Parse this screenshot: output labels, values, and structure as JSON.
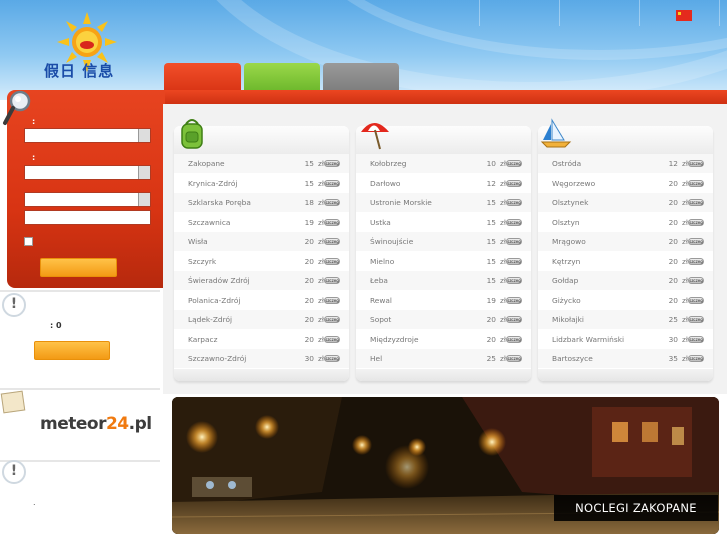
{
  "header": {
    "logo_text": "假日 信息",
    "flag_icon": "china-flag-icon",
    "tabs": [
      {
        "label": "",
        "color": "#e23c1a"
      },
      {
        "label": "",
        "color": "#86c83c"
      },
      {
        "label": "",
        "color": "#8c8c8c"
      }
    ]
  },
  "search": {
    "field1_label": ":",
    "field2_label": ":",
    "field1_value": "",
    "field2_value": "",
    "field3_value": "",
    "field4_value": "",
    "submit_label": ""
  },
  "sidebar": {
    "counter_text": ": 0",
    "button_label": "",
    "partner_logo": {
      "main": "meteor",
      "accent": "24",
      "tail": ".pl"
    },
    "footer_text": "."
  },
  "columns": [
    {
      "icon": "backpack-icon",
      "rows": [
        {
          "town": "Zakopane",
          "price": "15",
          "unit": "zł"
        },
        {
          "town": "Krynica-Zdrój",
          "price": "15",
          "unit": "zł"
        },
        {
          "town": "Szklarska Poręba",
          "price": "18",
          "unit": "zł"
        },
        {
          "town": "Szczawnica",
          "price": "19",
          "unit": "zł"
        },
        {
          "town": "Wisła",
          "price": "20",
          "unit": "zł"
        },
        {
          "town": "Szczyrk",
          "price": "20",
          "unit": "zł"
        },
        {
          "town": "Świeradów Zdrój",
          "price": "20",
          "unit": "zł"
        },
        {
          "town": "Polanica-Zdrój",
          "price": "20",
          "unit": "zł"
        },
        {
          "town": "Lądek-Zdrój",
          "price": "20",
          "unit": "zł"
        },
        {
          "town": "Karpacz",
          "price": "20",
          "unit": "zł"
        },
        {
          "town": "Szczawno-Zdrój",
          "price": "30",
          "unit": "zł"
        }
      ]
    },
    {
      "icon": "beach-umbrella-icon",
      "rows": [
        {
          "town": "Kołobrzeg",
          "price": "10",
          "unit": "zł"
        },
        {
          "town": "Darłowo",
          "price": "12",
          "unit": "zł"
        },
        {
          "town": "Ustronie Morskie",
          "price": "15",
          "unit": "zł"
        },
        {
          "town": "Ustka",
          "price": "15",
          "unit": "zł"
        },
        {
          "town": "Świnoujście",
          "price": "15",
          "unit": "zł"
        },
        {
          "town": "Mielno",
          "price": "15",
          "unit": "zł"
        },
        {
          "town": "Łeba",
          "price": "15",
          "unit": "zł"
        },
        {
          "town": "Rewal",
          "price": "19",
          "unit": "zł"
        },
        {
          "town": "Sopot",
          "price": "20",
          "unit": "zł"
        },
        {
          "town": "Międzyzdroje",
          "price": "20",
          "unit": "zł"
        },
        {
          "town": "Hel",
          "price": "25",
          "unit": "zł"
        }
      ]
    },
    {
      "icon": "sailboat-icon",
      "rows": [
        {
          "town": "Ostróda",
          "price": "12",
          "unit": "zł"
        },
        {
          "town": "Węgorzewo",
          "price": "20",
          "unit": "zł"
        },
        {
          "town": "Olsztynek",
          "price": "20",
          "unit": "zł"
        },
        {
          "town": "Olsztyn",
          "price": "20",
          "unit": "zł"
        },
        {
          "town": "Mrągowo",
          "price": "20",
          "unit": "zł"
        },
        {
          "town": "Kętrzyn",
          "price": "20",
          "unit": "zł"
        },
        {
          "town": "Gołdap",
          "price": "20",
          "unit": "zł"
        },
        {
          "town": "Giżycko",
          "price": "20",
          "unit": "zł"
        },
        {
          "town": "Mikołajki",
          "price": "25",
          "unit": "zł"
        },
        {
          "town": "Lidzbark Warmiński",
          "price": "30",
          "unit": "zł"
        },
        {
          "town": "Bartoszyce",
          "price": "35",
          "unit": "zł"
        }
      ]
    }
  ],
  "pill_label": "szczeg",
  "banner": {
    "caption": "NOCLEGI ZAKOPANE"
  }
}
